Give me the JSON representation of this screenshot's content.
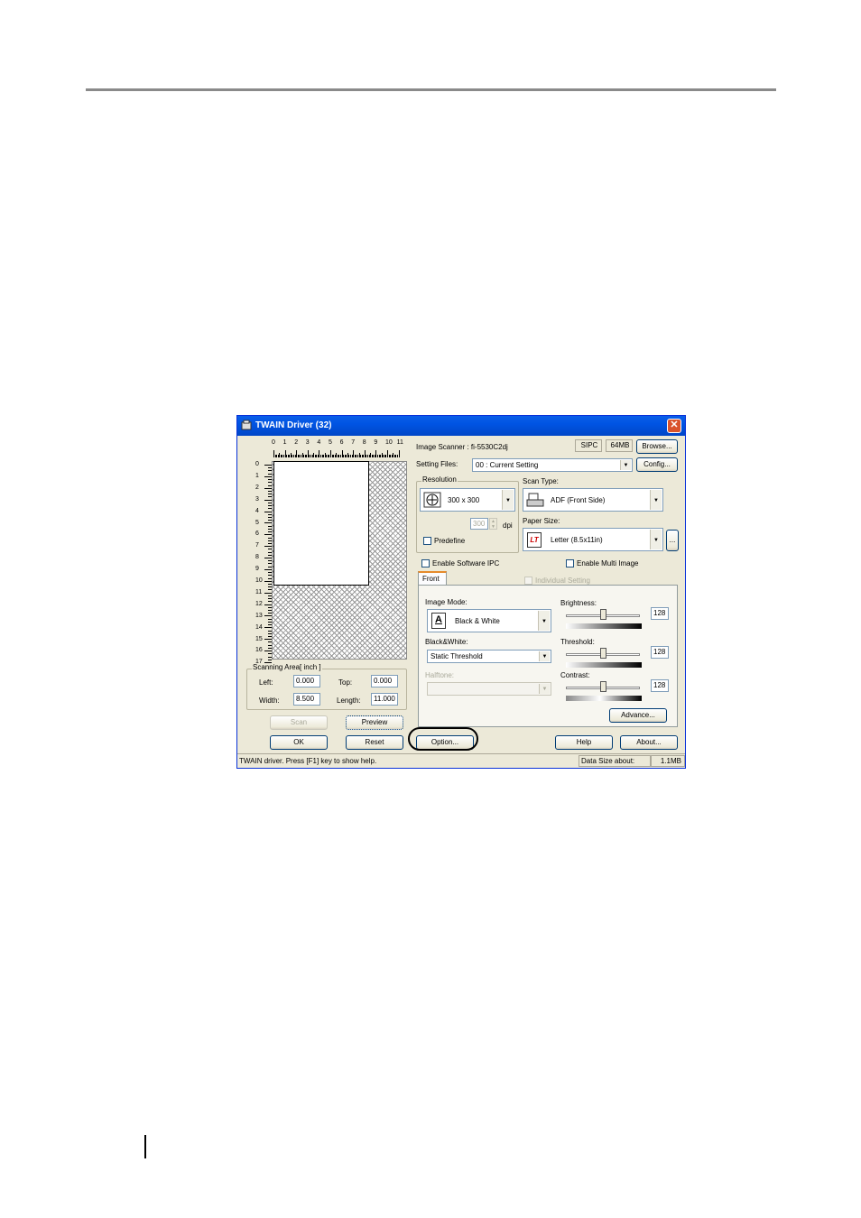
{
  "dialog": {
    "title": "TWAIN Driver (32)",
    "close_glyph": "✕",
    "ruler_top": [
      "0",
      "1",
      "2",
      "3",
      "4",
      "5",
      "6",
      "7",
      "8",
      "9",
      "10",
      "11"
    ],
    "ruler_left": [
      "0",
      "1",
      "2",
      "3",
      "4",
      "5",
      "6",
      "7",
      "8",
      "9",
      "10",
      "11",
      "12",
      "13",
      "14",
      "15",
      "16",
      "17"
    ],
    "scanning_area": {
      "label": "Scanning Area[ inch ]",
      "left_label": "Left:",
      "left_value": "0.000",
      "top_label": "Top:",
      "top_value": "0.000",
      "width_label": "Width:",
      "width_value": "8.500",
      "length_label": "Length:",
      "length_value": "11.000"
    },
    "buttons": {
      "scan": "Scan",
      "preview": "Preview",
      "ok": "OK",
      "reset": "Reset",
      "option": "Option...",
      "help": "Help",
      "about": "About...",
      "browse": "Browse...",
      "config": "Config...",
      "advance": "Advance...",
      "more": "..."
    },
    "scanner": {
      "label": "Image Scanner : fi-5530C2dj",
      "sipc": "SIPC",
      "memory": "64MB"
    },
    "setting_files": {
      "label": "Setting Files:",
      "value": "00 : Current Setting"
    },
    "resolution": {
      "label": "Resolution",
      "value": "300 x 300",
      "dpi_value": "300",
      "dpi_unit": "dpi",
      "predefine_label": "Predefine"
    },
    "scan_type": {
      "label": "Scan Type:",
      "value": "ADF (Front Side)"
    },
    "paper_size": {
      "label": "Paper Size:",
      "value": "Letter (8.5x11in)",
      "icon_text": "LT"
    },
    "enable_ipc": "Enable Software IPC",
    "enable_multi": "Enable Multi Image",
    "tab_front": "Front",
    "individual_setting": "Individual Setting",
    "image_mode": {
      "label": "Image Mode:",
      "value": "Black & White"
    },
    "black_white": {
      "label": "Black&White:",
      "value": "Static Threshold"
    },
    "halftone": {
      "label": "Halftone:",
      "value": ""
    },
    "brightness": {
      "label": "Brightness:",
      "value": "128",
      "level": 0.5
    },
    "threshold": {
      "label": "Threshold:",
      "value": "128",
      "level": 0.5
    },
    "contrast": {
      "label": "Contrast:",
      "value": "128",
      "level": 0.5
    },
    "status": {
      "hint": "TWAIN driver. Press [F1] key to show help.",
      "data_size_label": "Data Size about:",
      "data_size_value": "1.1MB"
    },
    "colors": {
      "title_bar": "#0054e3",
      "dialog_bg": "#ece9d8",
      "close": "#d9532c"
    }
  }
}
